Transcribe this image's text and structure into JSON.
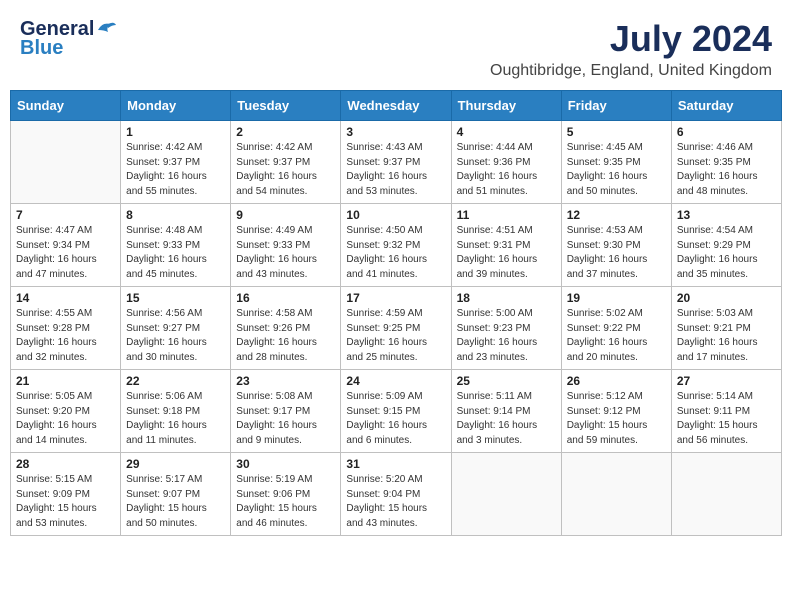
{
  "header": {
    "logo_general": "General",
    "logo_blue": "Blue",
    "month_title": "July 2024",
    "location": "Oughtibridge, England, United Kingdom"
  },
  "days_of_week": [
    "Sunday",
    "Monday",
    "Tuesday",
    "Wednesday",
    "Thursday",
    "Friday",
    "Saturday"
  ],
  "weeks": [
    [
      {
        "day": "",
        "info": ""
      },
      {
        "day": "1",
        "info": "Sunrise: 4:42 AM\nSunset: 9:37 PM\nDaylight: 16 hours and 55 minutes."
      },
      {
        "day": "2",
        "info": "Sunrise: 4:42 AM\nSunset: 9:37 PM\nDaylight: 16 hours and 54 minutes."
      },
      {
        "day": "3",
        "info": "Sunrise: 4:43 AM\nSunset: 9:37 PM\nDaylight: 16 hours and 53 minutes."
      },
      {
        "day": "4",
        "info": "Sunrise: 4:44 AM\nSunset: 9:36 PM\nDaylight: 16 hours and 51 minutes."
      },
      {
        "day": "5",
        "info": "Sunrise: 4:45 AM\nSunset: 9:35 PM\nDaylight: 16 hours and 50 minutes."
      },
      {
        "day": "6",
        "info": "Sunrise: 4:46 AM\nSunset: 9:35 PM\nDaylight: 16 hours and 48 minutes."
      }
    ],
    [
      {
        "day": "7",
        "info": "Sunrise: 4:47 AM\nSunset: 9:34 PM\nDaylight: 16 hours and 47 minutes."
      },
      {
        "day": "8",
        "info": "Sunrise: 4:48 AM\nSunset: 9:33 PM\nDaylight: 16 hours and 45 minutes."
      },
      {
        "day": "9",
        "info": "Sunrise: 4:49 AM\nSunset: 9:33 PM\nDaylight: 16 hours and 43 minutes."
      },
      {
        "day": "10",
        "info": "Sunrise: 4:50 AM\nSunset: 9:32 PM\nDaylight: 16 hours and 41 minutes."
      },
      {
        "day": "11",
        "info": "Sunrise: 4:51 AM\nSunset: 9:31 PM\nDaylight: 16 hours and 39 minutes."
      },
      {
        "day": "12",
        "info": "Sunrise: 4:53 AM\nSunset: 9:30 PM\nDaylight: 16 hours and 37 minutes."
      },
      {
        "day": "13",
        "info": "Sunrise: 4:54 AM\nSunset: 9:29 PM\nDaylight: 16 hours and 35 minutes."
      }
    ],
    [
      {
        "day": "14",
        "info": "Sunrise: 4:55 AM\nSunset: 9:28 PM\nDaylight: 16 hours and 32 minutes."
      },
      {
        "day": "15",
        "info": "Sunrise: 4:56 AM\nSunset: 9:27 PM\nDaylight: 16 hours and 30 minutes."
      },
      {
        "day": "16",
        "info": "Sunrise: 4:58 AM\nSunset: 9:26 PM\nDaylight: 16 hours and 28 minutes."
      },
      {
        "day": "17",
        "info": "Sunrise: 4:59 AM\nSunset: 9:25 PM\nDaylight: 16 hours and 25 minutes."
      },
      {
        "day": "18",
        "info": "Sunrise: 5:00 AM\nSunset: 9:23 PM\nDaylight: 16 hours and 23 minutes."
      },
      {
        "day": "19",
        "info": "Sunrise: 5:02 AM\nSunset: 9:22 PM\nDaylight: 16 hours and 20 minutes."
      },
      {
        "day": "20",
        "info": "Sunrise: 5:03 AM\nSunset: 9:21 PM\nDaylight: 16 hours and 17 minutes."
      }
    ],
    [
      {
        "day": "21",
        "info": "Sunrise: 5:05 AM\nSunset: 9:20 PM\nDaylight: 16 hours and 14 minutes."
      },
      {
        "day": "22",
        "info": "Sunrise: 5:06 AM\nSunset: 9:18 PM\nDaylight: 16 hours and 11 minutes."
      },
      {
        "day": "23",
        "info": "Sunrise: 5:08 AM\nSunset: 9:17 PM\nDaylight: 16 hours and 9 minutes."
      },
      {
        "day": "24",
        "info": "Sunrise: 5:09 AM\nSunset: 9:15 PM\nDaylight: 16 hours and 6 minutes."
      },
      {
        "day": "25",
        "info": "Sunrise: 5:11 AM\nSunset: 9:14 PM\nDaylight: 16 hours and 3 minutes."
      },
      {
        "day": "26",
        "info": "Sunrise: 5:12 AM\nSunset: 9:12 PM\nDaylight: 15 hours and 59 minutes."
      },
      {
        "day": "27",
        "info": "Sunrise: 5:14 AM\nSunset: 9:11 PM\nDaylight: 15 hours and 56 minutes."
      }
    ],
    [
      {
        "day": "28",
        "info": "Sunrise: 5:15 AM\nSunset: 9:09 PM\nDaylight: 15 hours and 53 minutes."
      },
      {
        "day": "29",
        "info": "Sunrise: 5:17 AM\nSunset: 9:07 PM\nDaylight: 15 hours and 50 minutes."
      },
      {
        "day": "30",
        "info": "Sunrise: 5:19 AM\nSunset: 9:06 PM\nDaylight: 15 hours and 46 minutes."
      },
      {
        "day": "31",
        "info": "Sunrise: 5:20 AM\nSunset: 9:04 PM\nDaylight: 15 hours and 43 minutes."
      },
      {
        "day": "",
        "info": ""
      },
      {
        "day": "",
        "info": ""
      },
      {
        "day": "",
        "info": ""
      }
    ]
  ]
}
